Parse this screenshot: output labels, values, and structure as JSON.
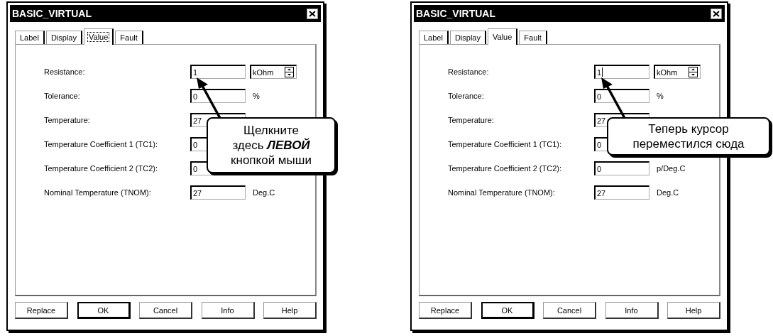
{
  "dialogs": [
    {
      "title": "BASIC_VIRTUAL",
      "tabs": [
        {
          "label": "Label",
          "selected": false,
          "focused": false
        },
        {
          "label": "Display",
          "selected": false,
          "focused": false
        },
        {
          "label": "Value",
          "selected": true,
          "focused": true
        },
        {
          "label": "Fault",
          "selected": false,
          "focused": false
        }
      ],
      "rows": [
        {
          "kind": "spinner",
          "label": "Resistance:",
          "value": "1",
          "caret": false,
          "unit": "kOhm"
        },
        {
          "kind": "unit",
          "label": "Tolerance:",
          "value": "0",
          "caret": false,
          "unit": "%"
        },
        {
          "kind": "plain",
          "label": "Temperature:",
          "value": "27",
          "caret": false
        },
        {
          "kind": "plain",
          "label": "Temperature Coefficient 1 (TC1):",
          "value": "0",
          "caret": false
        },
        {
          "kind": "plain",
          "label": "Temperature Coefficient 2 (TC2):",
          "value": "0",
          "caret": false
        },
        {
          "kind": "unit",
          "label": "Nominal Temperature (TNOM):",
          "value": "27",
          "caret": false,
          "unit": "Deg.C"
        }
      ],
      "buttons": [
        {
          "label": "Replace",
          "default": false
        },
        {
          "label": "OK",
          "default": true
        },
        {
          "label": "Cancel",
          "default": false
        },
        {
          "label": "Info",
          "default": false
        },
        {
          "label": "Help",
          "default": false
        }
      ],
      "callout": {
        "lines": [
          "Щелкните",
          "здесь **ЛЕВОЙ**",
          "кнопкой мыши"
        ]
      }
    },
    {
      "title": "BASIC_VIRTUAL",
      "tabs": [
        {
          "label": "Label",
          "selected": false,
          "focused": false
        },
        {
          "label": "Display",
          "selected": false,
          "focused": false
        },
        {
          "label": "Value",
          "selected": true,
          "focused": false
        },
        {
          "label": "Fault",
          "selected": false,
          "focused": false
        }
      ],
      "rows": [
        {
          "kind": "spinner",
          "label": "Resistance:",
          "value": "1",
          "caret": true,
          "unit": "kOhm"
        },
        {
          "kind": "unit",
          "label": "Tolerance:",
          "value": "0",
          "caret": false,
          "unit": "%"
        },
        {
          "kind": "plain",
          "label": "Temperature:",
          "value": "27",
          "caret": false
        },
        {
          "kind": "plain",
          "label": "Temperature Coefficient 1 (TC1):",
          "value": "0",
          "caret": false
        },
        {
          "kind": "unit",
          "label": "Temperature Coefficient 2 (TC2):",
          "value": "0",
          "caret": false,
          "unit": "p/Deg.C"
        },
        {
          "kind": "unit",
          "label": "Nominal Temperature (TNOM):",
          "value": "27",
          "caret": false,
          "unit": "Deg.C"
        }
      ],
      "buttons": [
        {
          "label": "Replace",
          "default": false
        },
        {
          "label": "OK",
          "default": true
        },
        {
          "label": "Cancel",
          "default": false
        },
        {
          "label": "Info",
          "default": false
        },
        {
          "label": "Help",
          "default": false
        }
      ],
      "callout": {
        "lines": [
          "Теперь курсор",
          "переместился сюда"
        ]
      }
    }
  ]
}
